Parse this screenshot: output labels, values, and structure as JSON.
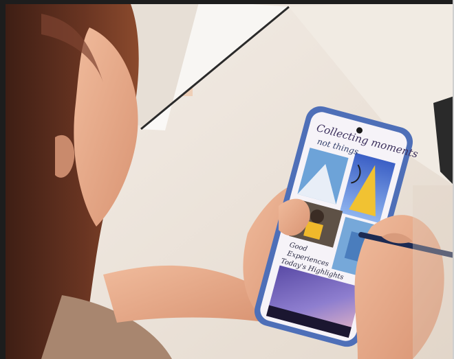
{
  "photo": {
    "subject": "woman holding smartphone with stylus",
    "colors": {
      "background": "#e9e1d8",
      "panel": "#f3eee8",
      "phone_frame": "#5577c0",
      "pen": "#1c2a52",
      "hair": "#5b2e1e",
      "skin": "#e6ad8e"
    }
  },
  "screen": {
    "headline_line1": "Collecting moments",
    "headline_line2": "not things",
    "caption_line1": "Good",
    "caption_line2": "Experiences",
    "caption_line3": "Today's Highlights"
  }
}
